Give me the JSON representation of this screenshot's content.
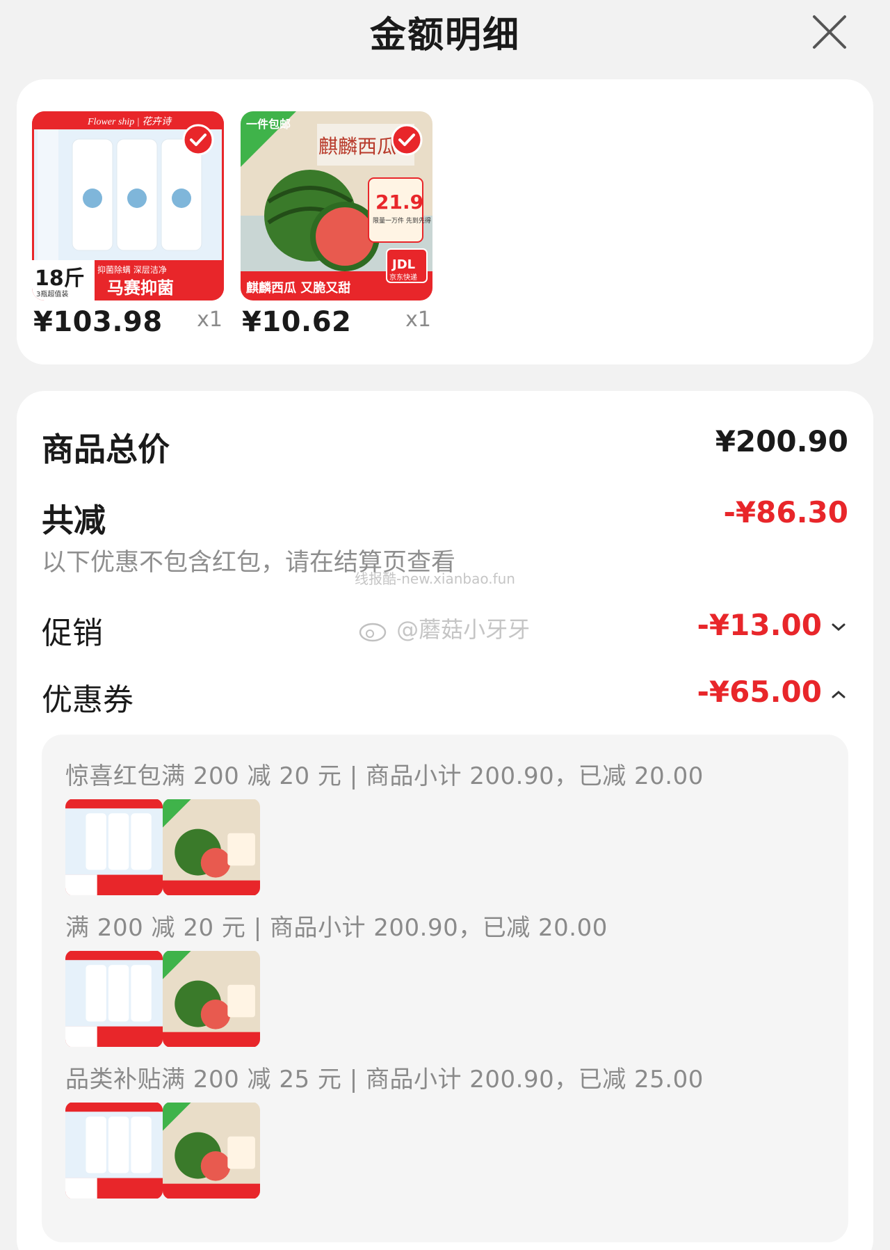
{
  "header": {
    "title": "金额明细",
    "close_icon": "close-icon"
  },
  "products": [
    {
      "name": "Flower ship 花卉诗 马赛抑菌洗衣液",
      "price": "¥103.98",
      "qty": "x1",
      "selected": true,
      "img": {
        "brand": "Flower ship | 花卉诗",
        "weight": "18斤",
        "weight_sub": "3瓶超值装",
        "tag1": "抑菌除螨  深层洁净",
        "banner": "马赛抑菌"
      }
    },
    {
      "name": "麒麟西瓜",
      "price": "¥10.62",
      "qty": "x1",
      "selected": true,
      "img": {
        "badge": "一件包邮",
        "title": "麒麟西瓜",
        "price_tag": "21.9",
        "price_tag_sub": "限量一万件 先到先得",
        "banner": "麒麟西瓜 又脆又甜",
        "jdl": "JDL",
        "jdl_sub": "京东快递"
      }
    }
  ],
  "summary": {
    "total_label": "商品总价",
    "total_value": "¥200.90",
    "discount_label": "共减",
    "discount_value": "-¥86.30",
    "note": "以下优惠不包含红包，请在结算页查看",
    "promo_label": "促销",
    "promo_value": "-¥13.00",
    "coupon_label": "优惠券",
    "coupon_value": "-¥65.00"
  },
  "coupons": [
    {
      "text": "惊喜红包满 200 减 20 元 | 商品小计 200.90，已减 20.00"
    },
    {
      "text": "满 200 减 20 元 | 商品小计 200.90，已减 20.00"
    },
    {
      "text": "品类补贴满 200 减 25 元 | 商品小计 200.90，已减 25.00"
    }
  ],
  "watermarks": {
    "site": "线报酷-new.xianbao.fun",
    "weibo": "@蘑菇小牙牙"
  },
  "colors": {
    "accent_red": "#e8262a",
    "background": "#f2f2f2"
  }
}
